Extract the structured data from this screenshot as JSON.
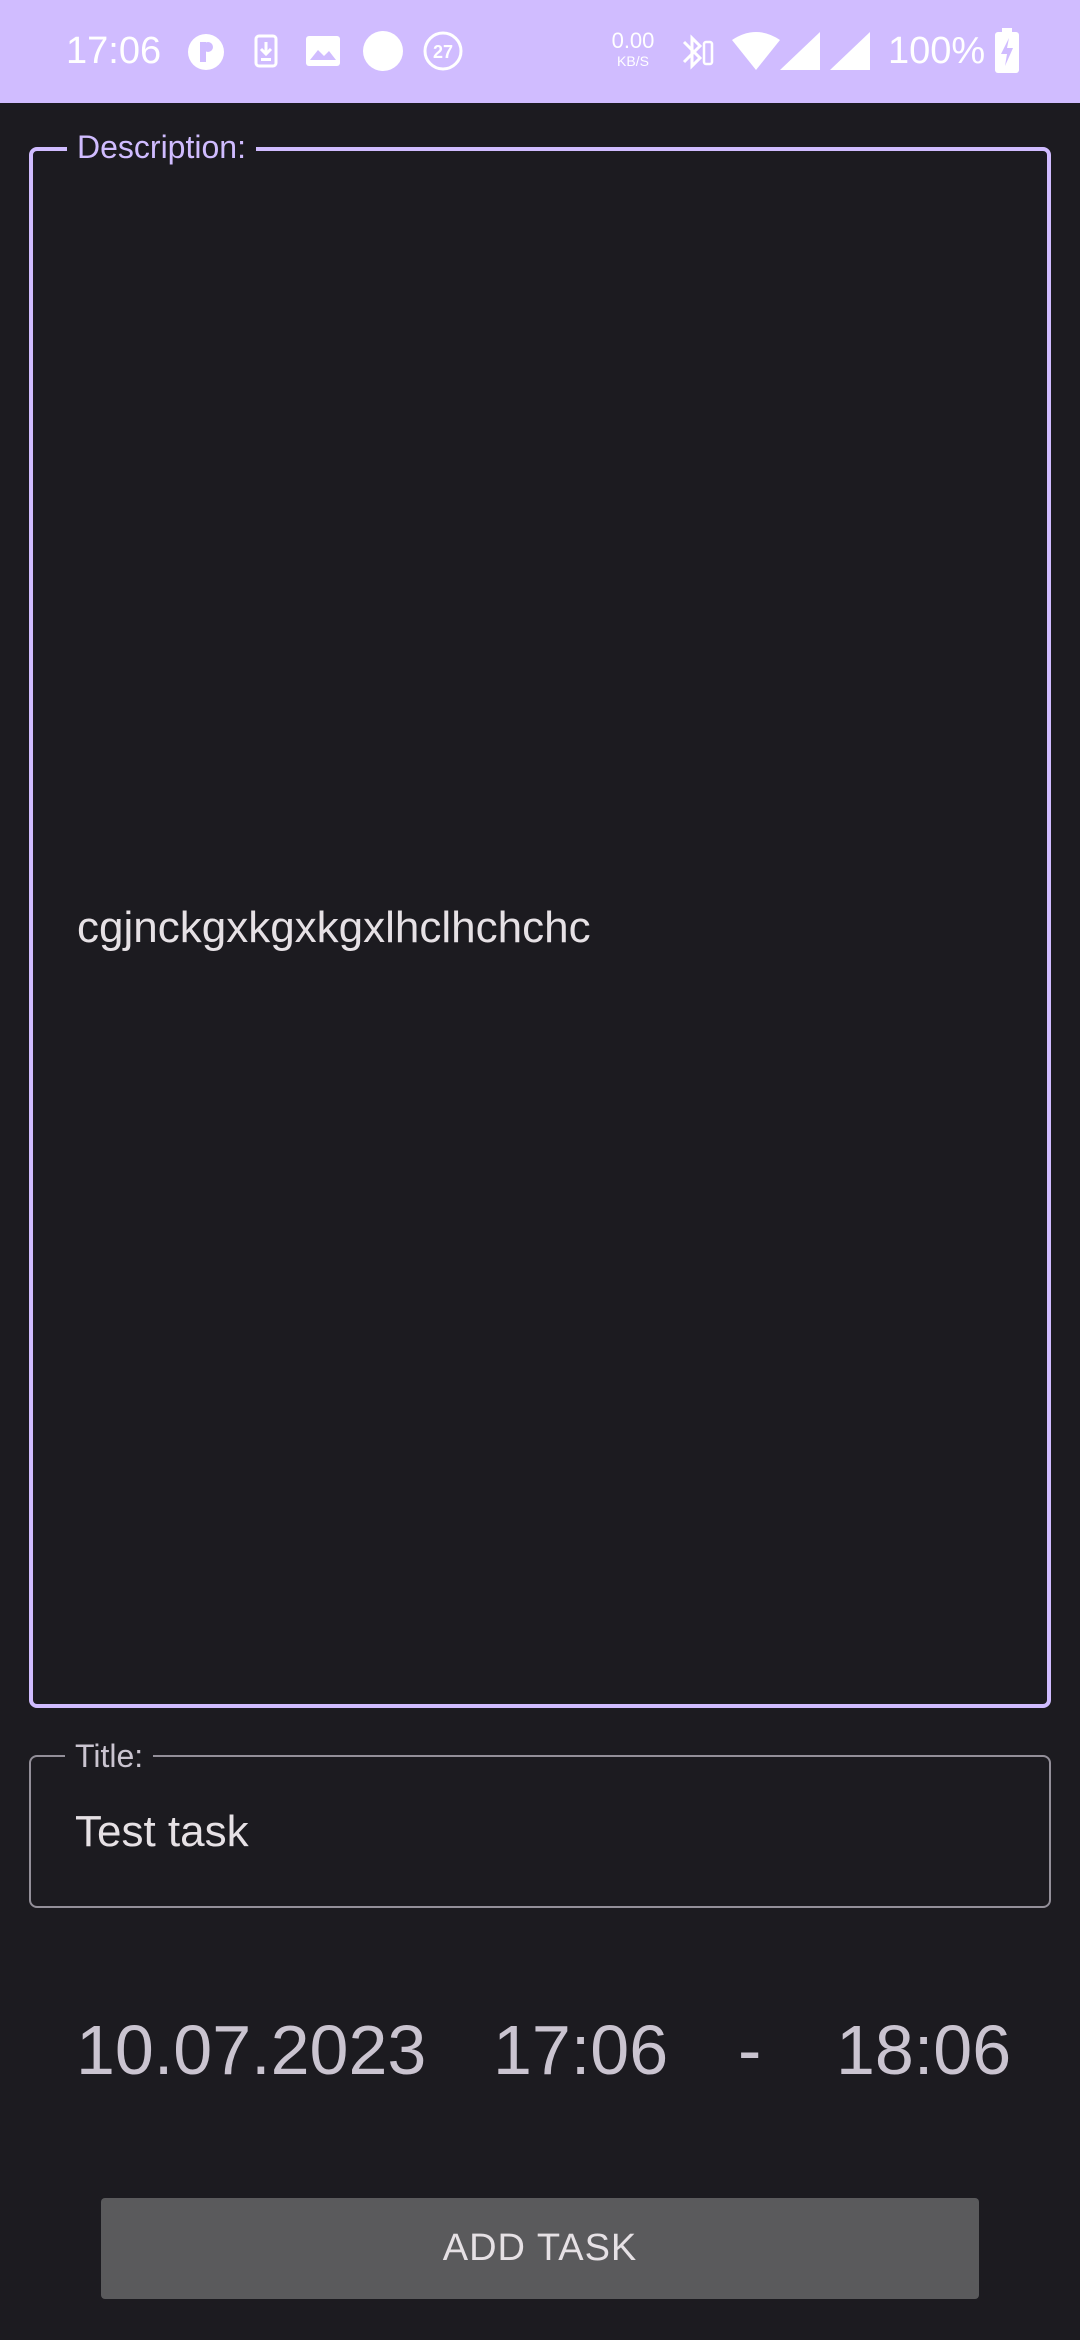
{
  "status_bar": {
    "time": "17:06",
    "notif_badge_count": "27",
    "net_speed_value": "0.00",
    "net_speed_unit": "KB/S",
    "battery_percent": "100%",
    "icons": [
      "podcast-app-icon",
      "download-icon",
      "image-icon",
      "circle-icon",
      "badge-27-icon",
      "bluetooth-battery-icon",
      "wifi-icon",
      "signal-icon",
      "signal-icon-2",
      "battery-charging-icon"
    ]
  },
  "description": {
    "label": "Description:",
    "value": "cgjnckgxkgxkgxlhclhchchc"
  },
  "title": {
    "label": "Title:",
    "value": "Test task"
  },
  "datetime": {
    "date": "10.07.2023",
    "start_time": "17:06",
    "separator": "-",
    "end_time": "18:06"
  },
  "add_button": {
    "label": "ADD TASK"
  },
  "colors": {
    "accent": "#d0bcff",
    "background": "#1c1b20",
    "button": "#5a5a5c"
  }
}
